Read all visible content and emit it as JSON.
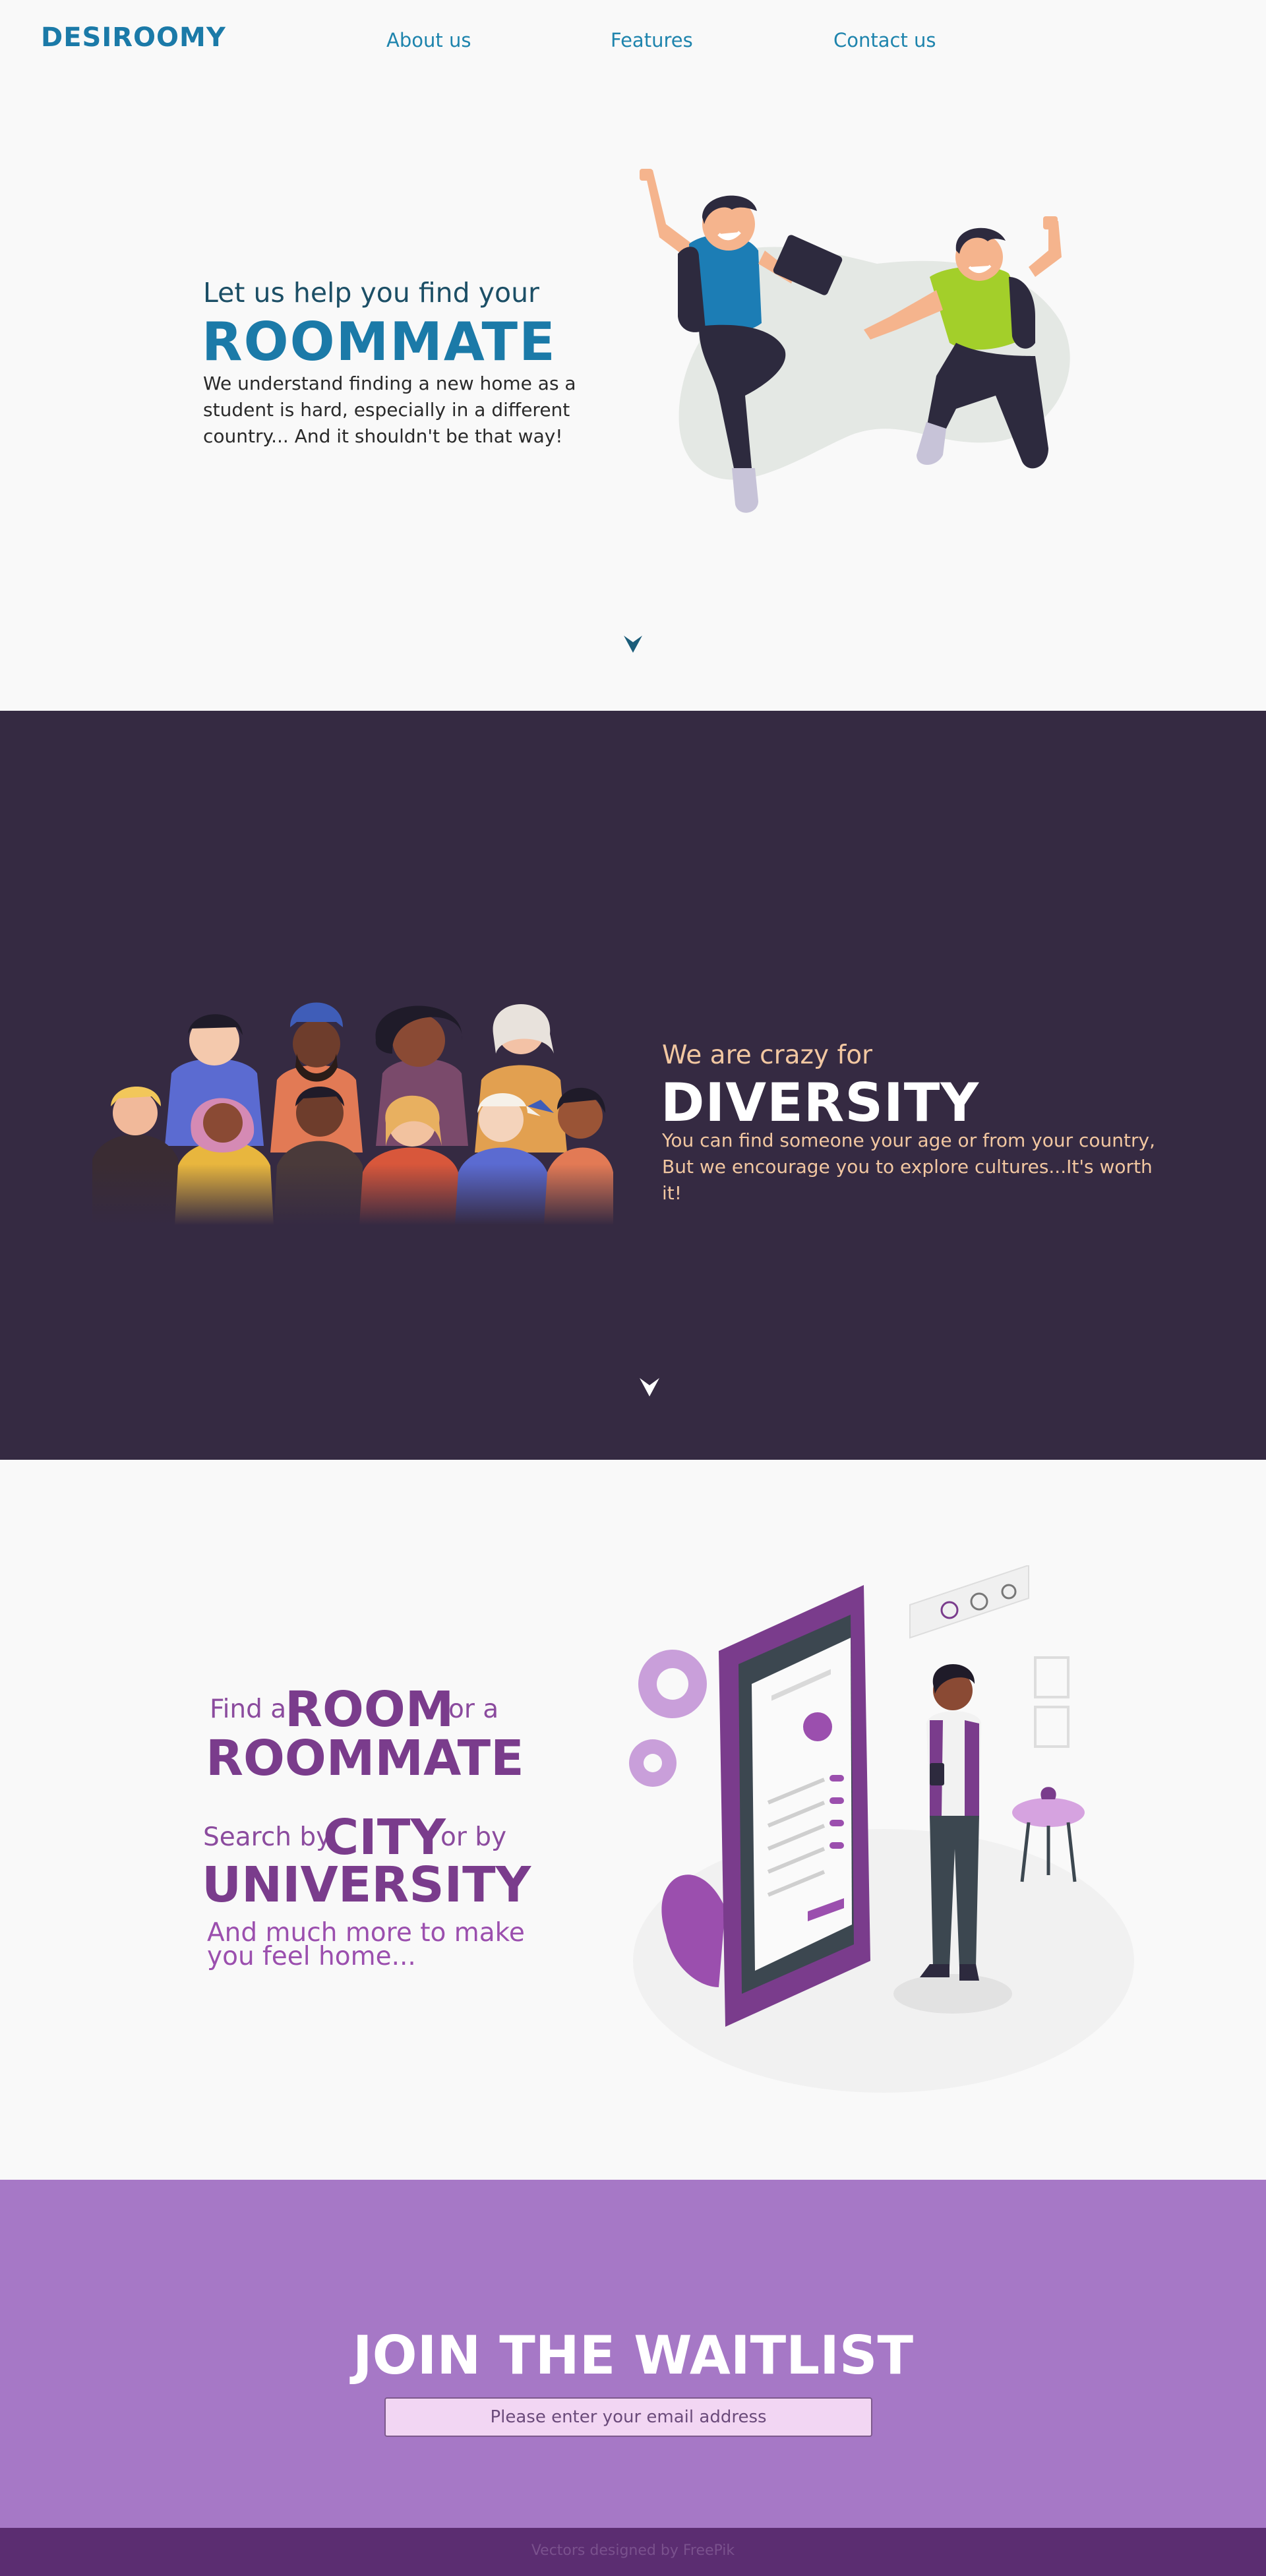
{
  "nav": {
    "logo": "DESIROOMY",
    "links": [
      "About us",
      "Features",
      "Contact us"
    ]
  },
  "hero": {
    "subtitle": "Let us help you find your",
    "title": "ROOMMATE",
    "text": "We understand finding a new home as a student is hard, especially in a different country... And it shouldn't be that way!"
  },
  "diversity": {
    "subtitle": "We are crazy for",
    "title": "DIVERSITY",
    "text": "You can find someone your age or from your country, But we encourage you to explore cultures...It's worth it!"
  },
  "features": {
    "find_a": "Find a",
    "room": "ROOM",
    "or_a": "or a",
    "roommate": "ROOMMATE",
    "search_by": "Search by",
    "city": "CITY",
    "or_by": "or by",
    "university": "UNIVERSITY",
    "more": "And much more to make you feel home..."
  },
  "waitlist": {
    "title": "JOIN THE WAITLIST",
    "placeholder": "Please enter your email address"
  },
  "footer": {
    "credit": "Vectors designed by FreePik"
  },
  "colors": {
    "brand_blue": "#1b7aa8",
    "dark_purple": "#352a42",
    "peach": "#f2c7a1",
    "purple": "#7a3c8c",
    "lavender": "#a678c6",
    "footer": "#5b2d71"
  }
}
